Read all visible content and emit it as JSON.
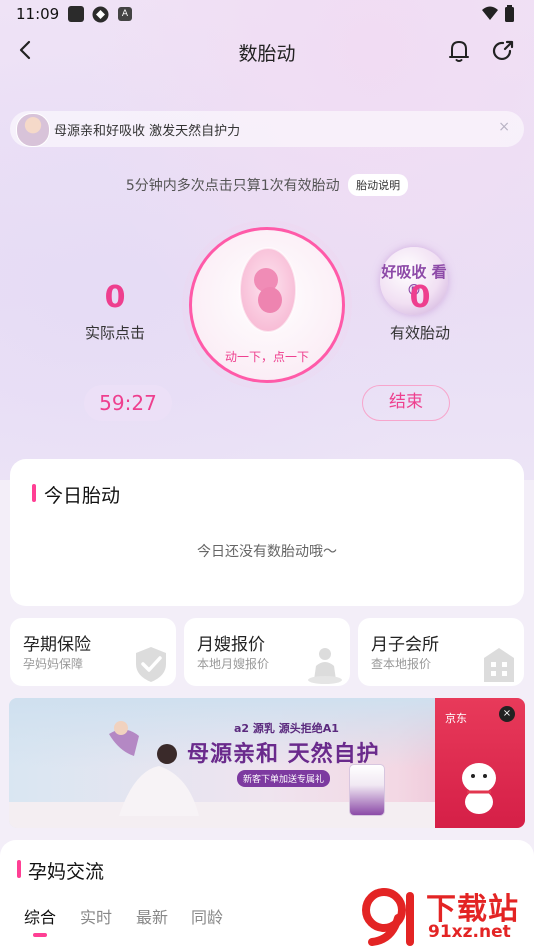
{
  "status_bar": {
    "time": "11:09",
    "a_glyph": "A"
  },
  "nav": {
    "title": "数胎动"
  },
  "ad_pill": {
    "text": "母源亲和好吸收 激发天然自护力",
    "close": "×"
  },
  "hint": {
    "text": "5分钟内多次点击只算1次有效胎动",
    "button": "胎动说明"
  },
  "counter": {
    "actual_value": "0",
    "actual_label": "实际点击",
    "effective_value": "0",
    "effective_label": "有效胎动",
    "tap_label": "动一下，点一下",
    "badge_text": "好吸收 看®",
    "timer": "59:27",
    "end_button": "结束"
  },
  "today": {
    "title": "今日胎动",
    "empty": "今日还没有数胎动哦～"
  },
  "services": [
    {
      "title": "孕期保险",
      "subtitle": "孕妈妈保障",
      "icon": "shield-check-icon"
    },
    {
      "title": "月嫂报价",
      "subtitle": "本地月嫂报价",
      "icon": "nanny-icon"
    },
    {
      "title": "月子会所",
      "subtitle": "查本地报价",
      "icon": "building-icon"
    }
  ],
  "banner": {
    "brand": "a2 源乳 源头拒绝A1",
    "headline": "母源亲和 天然自护",
    "sub": "新客下单加送专属礼",
    "jd_logo": "京东",
    "close": "×"
  },
  "community": {
    "title": "孕妈交流",
    "tabs": [
      "综合",
      "实时",
      "最新",
      "同龄"
    ],
    "active_tab": 0
  },
  "watermark": {
    "text": "下载站",
    "url": "91xz.net"
  },
  "colors": {
    "accent": "#ee3f8e",
    "accent_bright": "#ff3f94",
    "bg": "#f3eef8"
  }
}
